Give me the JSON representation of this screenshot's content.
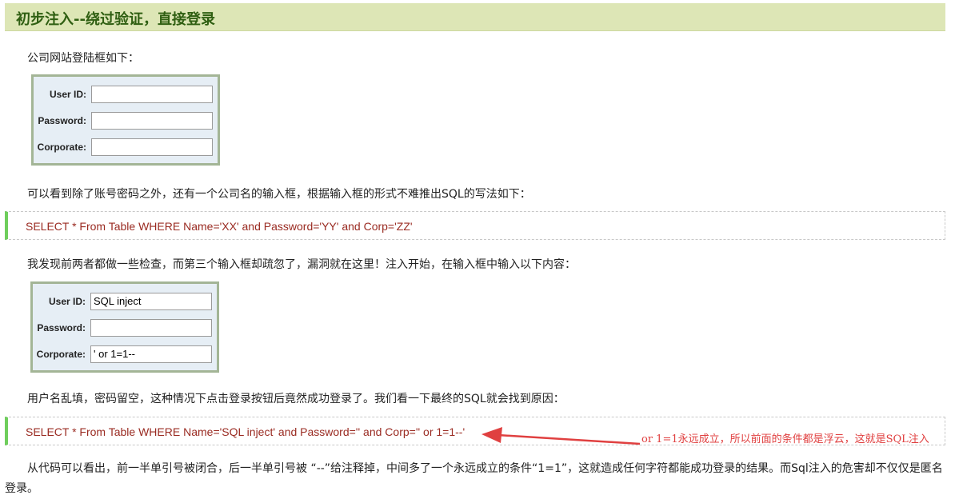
{
  "heading": {
    "title": "初步注入--绕过验证，直接登录"
  },
  "intro_text": "公司网站登陆框如下：",
  "form1": {
    "user_label": "User ID:",
    "user_value": "",
    "password_label": "Password:",
    "password_value": "",
    "corp_label": "Corporate:",
    "corp_value": ""
  },
  "para2": "可以看到除了账号密码之外，还有一个公司名的输入框，根据输入框的形式不难推出SQL的写法如下：",
  "code1": "SELECT * From Table WHERE Name='XX' and Password='YY' and Corp='ZZ'",
  "para3": "我发现前两者都做一些检查，而第三个输入框却疏忽了，漏洞就在这里！注入开始，在输入框中输入以下内容：",
  "form2": {
    "user_label": "User ID:",
    "user_value": "SQL inject",
    "password_label": "Password:",
    "password_value": "",
    "corp_label": "Corporate:",
    "corp_value": "' or 1=1--"
  },
  "para4": "用户名乱填，密码留空，这种情况下点击登录按钮后竟然成功登录了。我们看一下最终的SQL就会找到原因：",
  "code2": "SELECT * From Table WHERE Name='SQL inject' and Password='' and Corp='' or 1=1--'",
  "annotation": "or 1=1永远成立，所以前面的条件都是浮云，这就是SQL注入",
  "para5": "从代码可以看出，前一半单引号被闭合，后一半单引号被 “--”给注释掉，中间多了一个永远成立的条件“1=1”，这就造成任何字符都能成功登录的结果。而Sql注入的危害却不仅仅是匿名登录。",
  "colors": {
    "heading_bg": "#dde6b6",
    "heading_text": "#2f5f12",
    "code_text": "#9a2b22",
    "code_accent": "#6fce5c",
    "annotation": "#e04040"
  }
}
